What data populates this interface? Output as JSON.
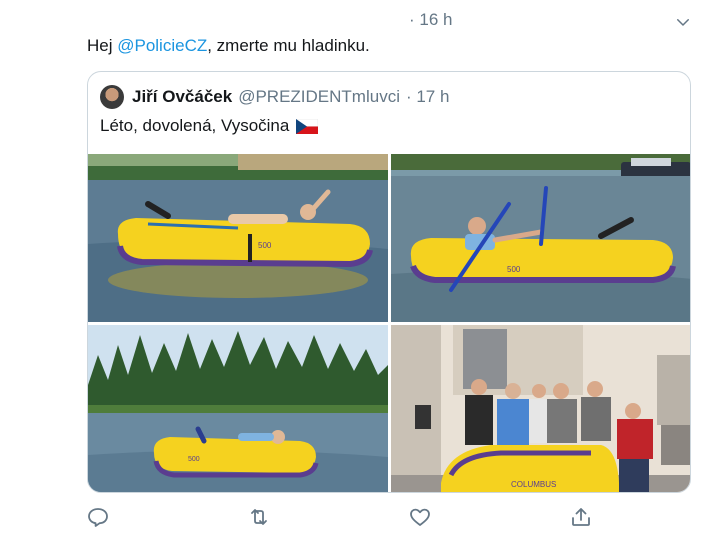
{
  "tweet": {
    "time": "· 16 h",
    "text_prefix": "Hej ",
    "mention": "@PolicieCZ",
    "text_suffix": ", zmerte mu hladinku."
  },
  "quote": {
    "name": "Jiří Ovčáček",
    "handle": "@PREZIDENTmluvci",
    "time": "· 17 h",
    "text": "Léto, dovolená, Vysočina"
  },
  "photo_labels": [
    "500",
    "500",
    "500",
    "COLUMBUS"
  ],
  "icons": [
    "chevron-down-icon",
    "reply-icon",
    "retweet-icon",
    "like-icon",
    "share-icon",
    "czech-flag-icon"
  ],
  "colors": {
    "link": "#1b95e0",
    "muted": "#657786",
    "border": "#ccd6dd",
    "boat_yellow": "#f5d21f",
    "boat_purple": "#5a3d8f"
  }
}
